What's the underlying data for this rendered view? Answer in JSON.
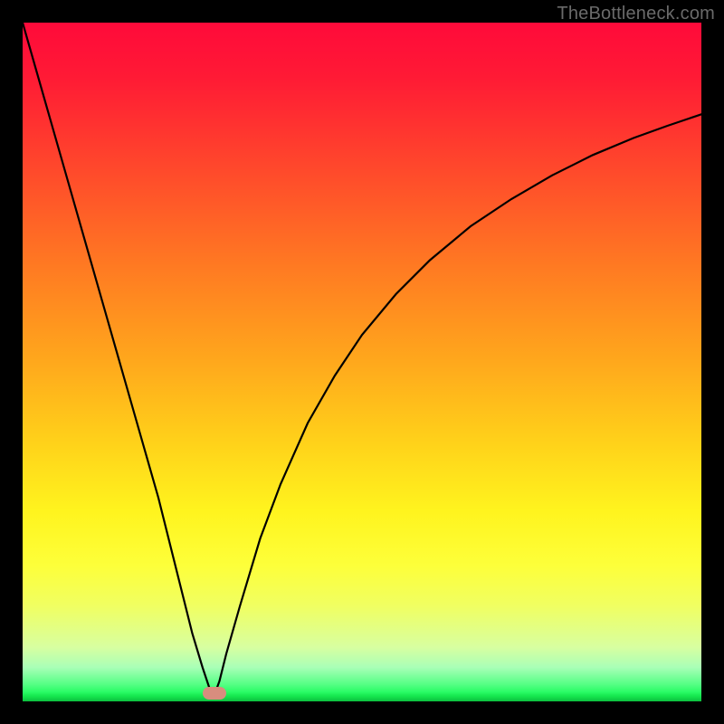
{
  "watermark": "TheBottleneck.com",
  "gradient_colors": {
    "top": "#ff0a3a",
    "mid_upper": "#ff7a22",
    "mid": "#ffd21a",
    "mid_lower": "#fdff3a",
    "lower": "#a9ffb7",
    "bottom": "#0cbf3f"
  },
  "marker": {
    "color": "#d88d7e",
    "x_fraction": 0.282,
    "y_fraction": 0.988
  },
  "chart_data": {
    "type": "line",
    "title": "",
    "xlabel": "",
    "ylabel": "",
    "xlim": [
      0,
      100
    ],
    "ylim": [
      0,
      100
    ],
    "grid": false,
    "legend": null,
    "series": [
      {
        "name": "left-branch",
        "x": [
          0,
          4,
          8,
          12,
          16,
          20,
          23,
          25,
          26.5,
          27.5,
          28.2
        ],
        "y": [
          100,
          86,
          72,
          58,
          44,
          30,
          18,
          10,
          5,
          2,
          0.8
        ]
      },
      {
        "name": "right-branch",
        "x": [
          28.2,
          29,
          30,
          32,
          35,
          38,
          42,
          46,
          50,
          55,
          60,
          66,
          72,
          78,
          84,
          90,
          95,
          100
        ],
        "y": [
          0.8,
          3,
          7,
          14,
          24,
          32,
          41,
          48,
          54,
          60,
          65,
          70,
          74,
          77.5,
          80.5,
          83,
          84.8,
          86.5
        ]
      }
    ],
    "annotations": [
      {
        "type": "marker",
        "x": 28.2,
        "y": 1.2,
        "shape": "rounded-rect",
        "color": "#d88d7e"
      }
    ]
  }
}
